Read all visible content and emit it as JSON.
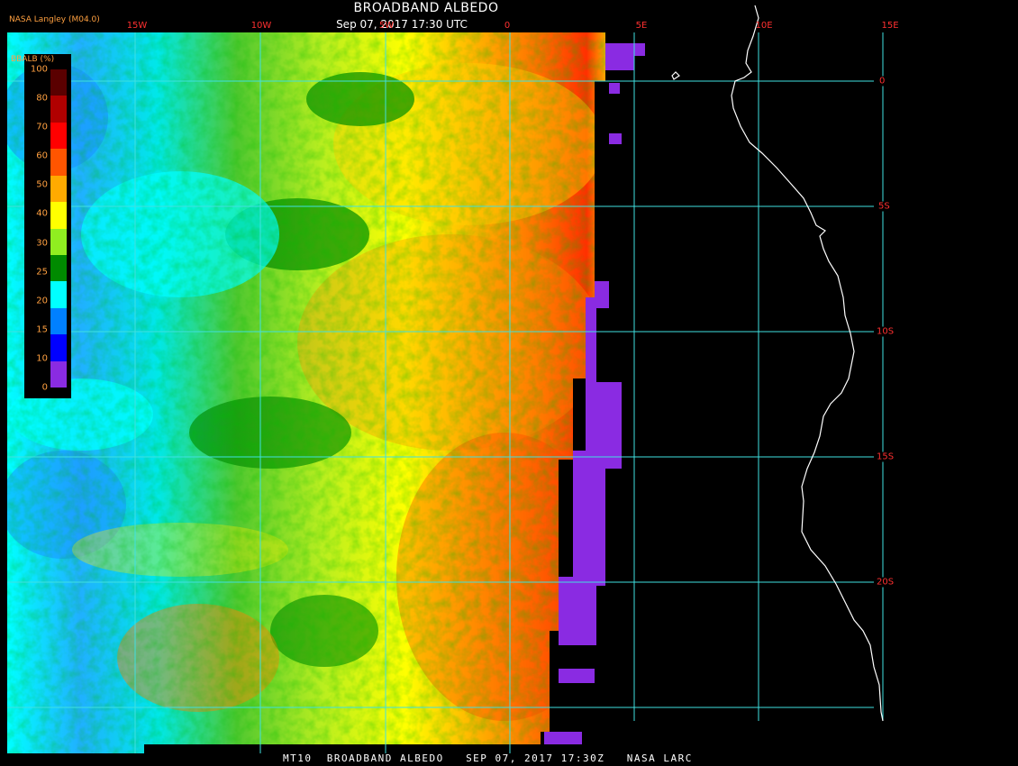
{
  "header": {
    "title": "BROADBAND ALBEDO",
    "subtitle": "Sep 07, 2017 17:30 UTC",
    "credit": "NASA Langley (M04.0)"
  },
  "footer": {
    "text": "MT10  BROADBAND ALBEDO   SEP 07, 2017 17:30Z   NASA LARC"
  },
  "legend": {
    "title": "BBALB (%)",
    "ticks": [
      "100",
      "80",
      "70",
      "60",
      "50",
      "40",
      "30",
      "25",
      "20",
      "15",
      "10",
      "0"
    ],
    "colors": [
      "#5a0000",
      "#b00000",
      "#ff0000",
      "#ff5500",
      "#ffaa00",
      "#ffff00",
      "#90ee20",
      "#008a00",
      "#00ffff",
      "#0080ff",
      "#0000ff",
      "#8a2be2"
    ]
  },
  "grid": {
    "lon_labels": [
      "15W",
      "10W",
      "5W",
      "0",
      "5E",
      "10E",
      "15E"
    ],
    "lat_labels": [
      "0",
      "5S",
      "10S",
      "15S",
      "20S"
    ],
    "line_color": "#40e0e0",
    "label_color": "#ff3030"
  },
  "colors": {
    "background": "#000000",
    "coastline": "#ffffff"
  }
}
